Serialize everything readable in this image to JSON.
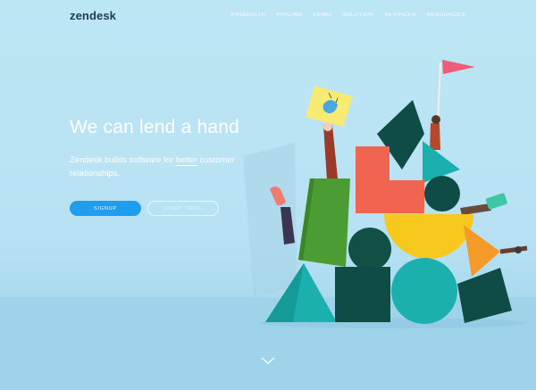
{
  "header": {
    "logo": "zendesk",
    "nav": [
      "PRODUCTS",
      "PRICING",
      "DEMO",
      "SOLUTION",
      "SERVICES",
      "RESOURCES"
    ]
  },
  "hero": {
    "title": "We can lend a hand",
    "subtitle_pre": "Zendesk builds software for ",
    "subtitle_emph": "better",
    "subtitle_post": " customer relationships.",
    "primary_cta": "SIGNUP",
    "secondary_cta": "START TRIAL"
  },
  "illustration": {
    "description_icon": "block-sculpture-illustration",
    "colors": {
      "dark_green": "#0f4c46",
      "coral": "#f06452",
      "teal": "#1bb0ae",
      "yellow": "#f7c81e",
      "grass_green": "#4b9c33",
      "orange": "#f49a28",
      "flag_pink": "#ee5c7a"
    }
  },
  "scroll_icon": "chevron-down-icon"
}
